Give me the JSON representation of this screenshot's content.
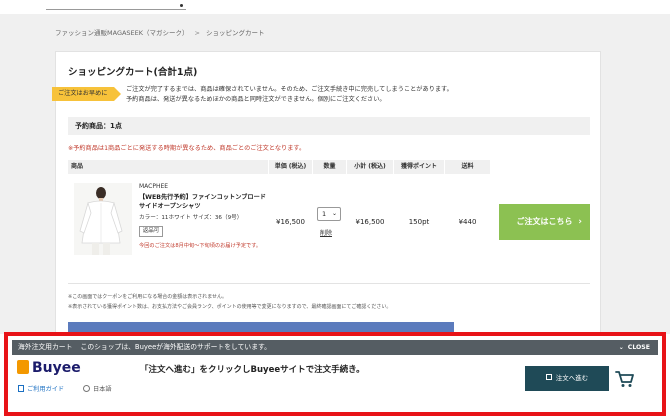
{
  "breadcrumb": {
    "items": [
      "ファッション通販MAGASEEK（マガシーク）",
      "ショッピングカート"
    ],
    "separator": ">"
  },
  "cart": {
    "title": "ショッピングカート(合計1点)",
    "notice_badge": "ご注文はお早めに",
    "notice_line1": "ご注文が完了するまでは、商品は確保されていません。そのため、ご注文手続き中に完売してしまうことがあります。",
    "notice_line2": "予約商品は、発送が異なるためほかの商品と同時注文ができません。個別にご注文ください。"
  },
  "section": {
    "header": "予約商品：1点",
    "warning": "※予約商品は1商品ごとに発送する時期が異なるため、商品ごとのご注文となります。",
    "columns": {
      "item": "商品",
      "price": "単価 (税込)",
      "qty": "数量",
      "subtotal": "小計 (税込)",
      "points": "獲得ポイント",
      "shipping": "送料"
    }
  },
  "product": {
    "brand": "MACPHEE",
    "name": "【WEB先行予約】ファインコットンブロードサイドオープンシャツ",
    "attrs": "カラー：11ホワイト サイズ：36（9号）",
    "return_badge": "返品可",
    "ship_note": "今回のご注文は8月中旬～下旬頃のお届け予定です。",
    "price": "¥16,500",
    "qty": "1",
    "delete_label": "削除",
    "subtotal": "¥16,500",
    "points": "150pt",
    "shipping": "¥440"
  },
  "order_button": {
    "label": "ご注文はこちら"
  },
  "footnotes": {
    "line1": "※この画面ではクーポンをご利用になる場合の金額は表示されません。",
    "line2": "※表示されている獲得ポイント数は、お支払方法やご会員ランク、ポイントの使用等で変更になりますので、最終確認画面にてご確認ください。"
  },
  "buyee": {
    "top_label": "海外注文用カート",
    "top_message": "このショップは、Buyeeが海外配送のサポートをしています。",
    "close_label": "CLOSE",
    "logo_text": "Buyee",
    "guide_label": "ご利用ガイド",
    "lang_label": "日本語",
    "message": "「注文へ進む」をクリックしBuyeeサイトで注文手続き。",
    "button_label": "注文へ進む"
  },
  "colors": {
    "accent_green": "#8cc152",
    "buyee_red_border": "#e81318",
    "buyee_button": "#1f4a57",
    "notice_yellow": "#f7c23a"
  },
  "icons": [
    "close-chevron-icon",
    "cart-icon",
    "external-link-icon",
    "guide-icon",
    "globe-icon",
    "select-chevron-icon"
  ]
}
